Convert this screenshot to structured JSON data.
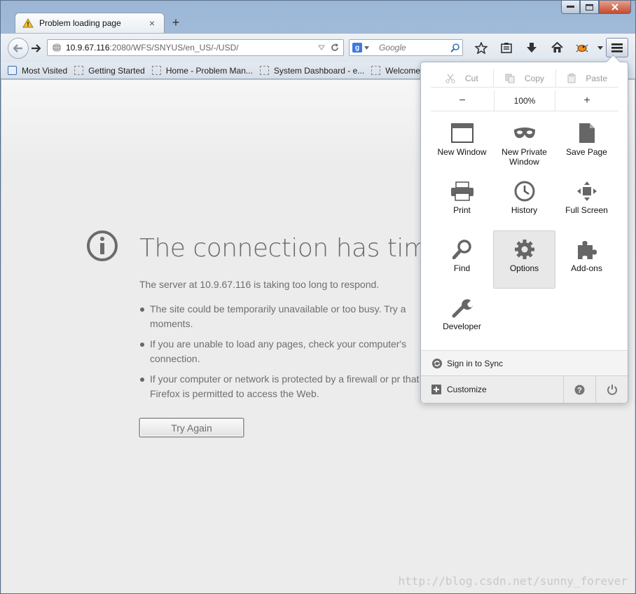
{
  "window": {
    "controls": [
      "minimize",
      "maximize",
      "close"
    ]
  },
  "tab": {
    "title": "Problem loading page",
    "close": "×",
    "new_tab": "+"
  },
  "navbar": {
    "url_host": "10.9.67.116",
    "url_path": ":2080/WFS/SNYUS/en_US/-/USD/",
    "search_placeholder": "Google"
  },
  "bookmarks": [
    {
      "label": "Most Visited"
    },
    {
      "label": "Getting Started"
    },
    {
      "label": "Home - Problem Man..."
    },
    {
      "label": "System Dashboard - e..."
    },
    {
      "label": "Welcome t"
    }
  ],
  "error": {
    "title": "The connection has timed",
    "intro": "The server at 10.9.67.116 is taking too long to respond.",
    "items": [
      "The site could be temporarily unavailable or too busy. Try a moments.",
      "If you are unable to load any pages, check your computer's connection.",
      "If your computer or network is protected by a firewall or pr that Firefox is permitted to access the Web."
    ],
    "button": "Try Again"
  },
  "panel": {
    "edit": {
      "cut": "Cut",
      "copy": "Copy",
      "paste": "Paste"
    },
    "zoom": {
      "minus": "−",
      "value": "100%",
      "plus": "+"
    },
    "items": [
      {
        "label": "New Window",
        "icon": "window-icon"
      },
      {
        "label": "New Private Window",
        "icon": "mask-icon"
      },
      {
        "label": "Save Page",
        "icon": "page-icon"
      },
      {
        "label": "Print",
        "icon": "printer-icon"
      },
      {
        "label": "History",
        "icon": "clock-icon"
      },
      {
        "label": "Full Screen",
        "icon": "fullscreen-icon"
      },
      {
        "label": "Find",
        "icon": "magnifier-icon"
      },
      {
        "label": "Options",
        "icon": "gear-icon",
        "active": true
      },
      {
        "label": "Add-ons",
        "icon": "puzzle-icon"
      },
      {
        "label": "Developer",
        "icon": "wrench-icon"
      }
    ],
    "sync": "Sign in to Sync",
    "customize": "Customize"
  },
  "watermark": "http://blog.csdn.net/sunny_forever",
  "colors": {
    "accent": "#3b79e4",
    "panel_bg": "#ffffff",
    "content_bg": "#ececec"
  }
}
